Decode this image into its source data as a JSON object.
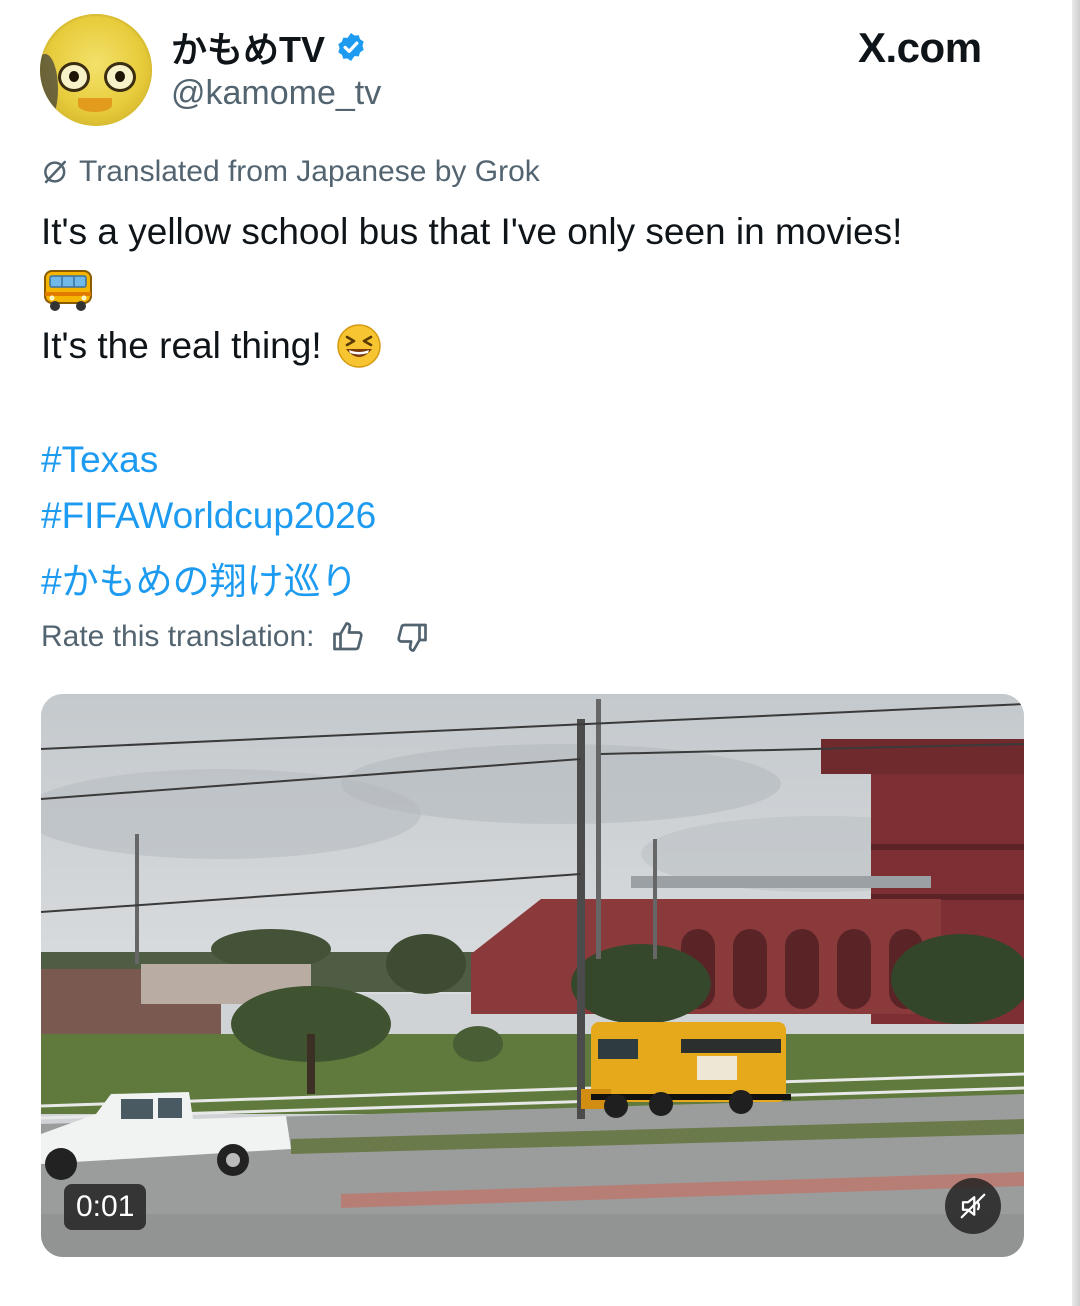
{
  "header": {
    "display_name": "かもめTV",
    "handle": "@kamome_tv",
    "site": "X.com",
    "accent_color": "#1d9bf0"
  },
  "translation": {
    "label": "Translated from Japanese by Grok",
    "rate_label": "Rate this translation:"
  },
  "tweet": {
    "line1": "It's a yellow school bus that I've only seen in movies!",
    "line2_emoji": "school-bus-emoji",
    "line3": "It's the real thing!",
    "line3_emoji": "grinning-squinting-face-emoji",
    "hashtags": [
      "#Texas",
      "#FIFAWorldcup2026",
      "#かもめの翔け巡り"
    ]
  },
  "video": {
    "timestamp": "0:01",
    "muted": true
  },
  "icons": {
    "verified": "verified-badge-icon",
    "translate": "translate-icon",
    "thumbs_up": "thumbs-up-icon",
    "thumbs_down": "thumbs-down-icon",
    "mute": "muted-speaker-icon"
  }
}
